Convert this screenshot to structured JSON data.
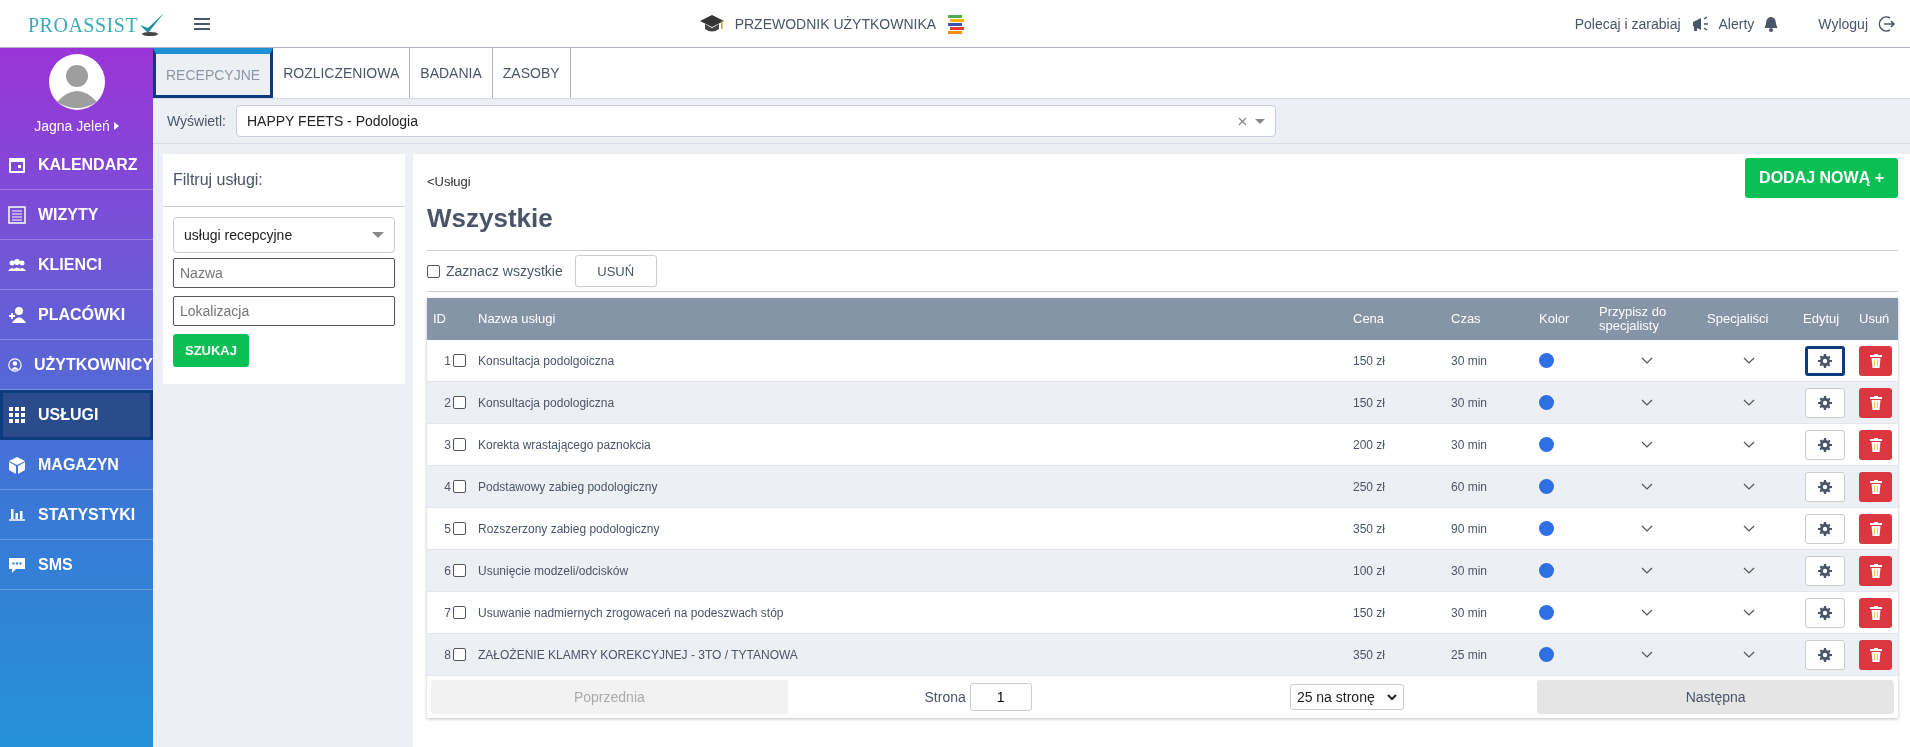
{
  "topbar": {
    "logo": "PROASSIST",
    "guide": "PRZEWODNIK UŻYTKOWNIKA",
    "refer": "Polecaj i zarabiaj",
    "alerts": "Alerty",
    "logout": "Wyloguj"
  },
  "user": {
    "name": "Jagna Jeleń"
  },
  "sidebar": {
    "items": [
      {
        "label": "KALENDARZ",
        "kind": "calendar",
        "selected": false
      },
      {
        "label": "WIZYTY",
        "kind": "list",
        "selected": false
      },
      {
        "label": "KLIENCI",
        "kind": "group",
        "selected": false
      },
      {
        "label": "PLACÓWKI",
        "kind": "useradd",
        "selected": false
      },
      {
        "label": "UŻYTKOWNICY",
        "kind": "usercircle",
        "selected": false
      },
      {
        "label": "USŁUGI",
        "kind": "grid",
        "selected": true
      },
      {
        "label": "MAGAZYN",
        "kind": "box",
        "selected": false
      },
      {
        "label": "STATYSTYKI",
        "kind": "chart",
        "selected": false
      },
      {
        "label": "SMS",
        "kind": "chat",
        "selected": false
      }
    ]
  },
  "tabs": [
    {
      "label": "RECEPCYJNE",
      "selected": true
    },
    {
      "label": "ROZLICZENIOWA",
      "selected": false
    },
    {
      "label": "BADANIA",
      "selected": false
    },
    {
      "label": "ZASOBY",
      "selected": false
    }
  ],
  "display": {
    "label": "Wyświetl:",
    "value": "HAPPY FEETS - Podologia"
  },
  "filter": {
    "title": "Filtruj usługi:",
    "type": "usługi recepcyjne",
    "name_placeholder": "Nazwa",
    "location_placeholder": "Lokalizacja",
    "search": "SZUKAJ"
  },
  "main": {
    "breadcrumb": "<Usługi",
    "title": "Wszystkie",
    "add": "DODAJ NOWĄ +",
    "select_all": "Zaznacz wszystkie",
    "select_all_checked": false,
    "delete": "USUŃ"
  },
  "table": {
    "columns": [
      "ID",
      "Nazwa usługi",
      "Cena",
      "Czas",
      "Kolor",
      "Przypisz do specjalisty",
      "Specjaliści",
      "Edytuj",
      "Usuń"
    ],
    "rows": [
      {
        "id": "1",
        "name": "Konsultacja podolgoiczna",
        "price": "150 zł",
        "time": "30 min",
        "color": "#2f6fe4",
        "checked": false,
        "focused": true
      },
      {
        "id": "2",
        "name": "Konsultacja podologiczna",
        "price": "150 zł",
        "time": "30 min",
        "color": "#2f6fe4",
        "checked": false,
        "focused": false
      },
      {
        "id": "3",
        "name": "Korekta wrastającego paznokcia",
        "price": "200 zł",
        "time": "30 min",
        "color": "#2f6fe4",
        "checked": false,
        "focused": false
      },
      {
        "id": "4",
        "name": "Podstawowy zabieg podologiczny",
        "price": "250 zł",
        "time": "60 min",
        "color": "#2f6fe4",
        "checked": false,
        "focused": false
      },
      {
        "id": "5",
        "name": "Rozszerzony zabieg podologiczny",
        "price": "350 zł",
        "time": "90 min",
        "color": "#2f6fe4",
        "checked": false,
        "focused": false
      },
      {
        "id": "6",
        "name": "Usunięcie modzeli/odcisków",
        "price": "100 zł",
        "time": "30 min",
        "color": "#2f6fe4",
        "checked": false,
        "focused": false
      },
      {
        "id": "7",
        "name": "Usuwanie nadmiernych zrogowaceń na podeszwach stóp",
        "price": "150 zł",
        "time": "30 min",
        "color": "#2f6fe4",
        "checked": false,
        "focused": false
      },
      {
        "id": "8",
        "name": "ZAŁOŻENIE KLAMRY KOREKCYJNEJ - 3TO / TYTANOWA",
        "price": "350 zł",
        "time": "25 min",
        "color": "#2f6fe4",
        "checked": false,
        "focused": false
      }
    ]
  },
  "pagination": {
    "prev": "Poprzednia",
    "page_label": "Strona",
    "page": "1",
    "per_page": "25 na stronę",
    "next": "Następna"
  }
}
